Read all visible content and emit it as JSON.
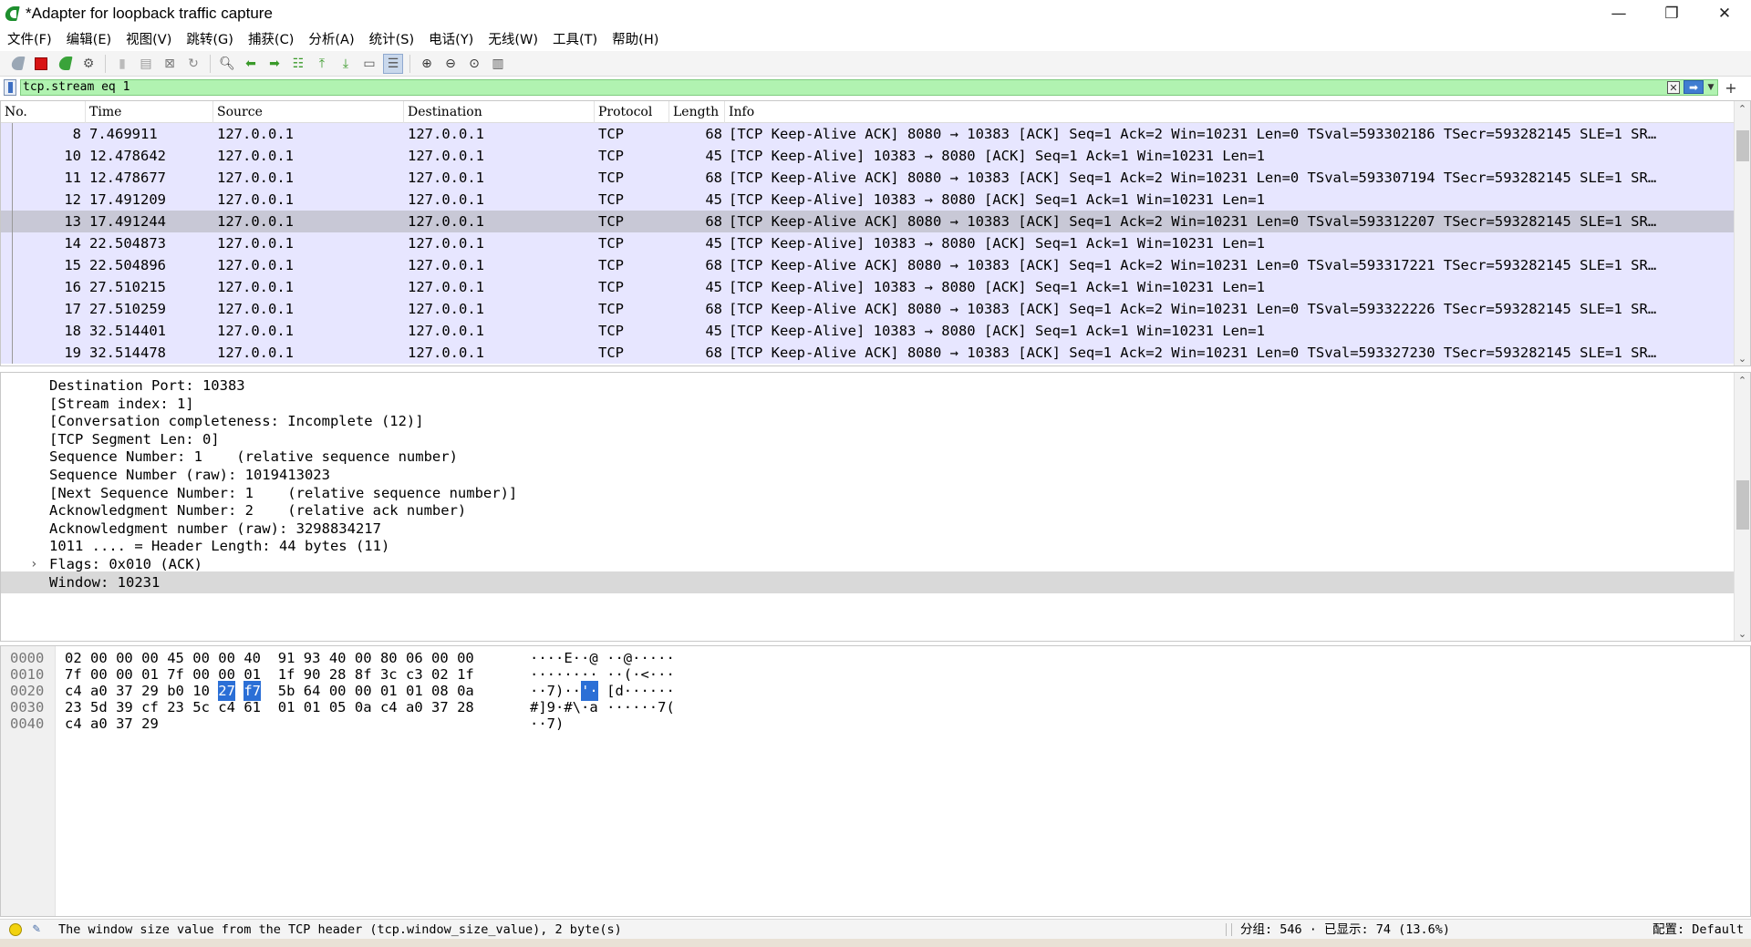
{
  "window": {
    "title": "*Adapter for loopback traffic capture",
    "controls": {
      "minimize": "—",
      "restore": "❐",
      "close": "✕"
    }
  },
  "menu": [
    "文件(F)",
    "编辑(E)",
    "视图(V)",
    "跳转(G)",
    "捕获(C)",
    "分析(A)",
    "统计(S)",
    "电话(Y)",
    "无线(W)",
    "工具(T)",
    "帮助(H)"
  ],
  "toolbar_icons": [
    "start-capture-icon",
    "stop-capture-icon",
    "restart-capture-icon",
    "capture-options-icon",
    "open-file-icon",
    "save-file-icon",
    "close-file-icon",
    "reload-file-icon",
    "find-packet-icon",
    "go-back-icon",
    "go-forward-icon",
    "go-to-packet-icon",
    "go-first-icon",
    "go-last-icon",
    "autoscroll-icon",
    "colorize-icon",
    "zoom-in-icon",
    "zoom-out-icon",
    "zoom-normal-icon",
    "resize-columns-icon"
  ],
  "filter": {
    "value": "tcp.stream eq 1",
    "valid_color": "#b1f3b1"
  },
  "packet_list": {
    "columns": [
      "No.",
      "Time",
      "Source",
      "Destination",
      "Protocol",
      "Length",
      "Info"
    ],
    "rows": [
      {
        "no": "8",
        "time": "7.469911",
        "src": "127.0.0.1",
        "dst": "127.0.0.1",
        "proto": "TCP",
        "len": "68",
        "info": "[TCP Keep-Alive ACK] 8080 → 10383 [ACK] Seq=1 Ack=2 Win=10231 Len=0 TSval=593302186 TSecr=593282145 SLE=1 SR…"
      },
      {
        "no": "10",
        "time": "12.478642",
        "src": "127.0.0.1",
        "dst": "127.0.0.1",
        "proto": "TCP",
        "len": "45",
        "info": "[TCP Keep-Alive] 10383 → 8080 [ACK] Seq=1 Ack=1 Win=10231 Len=1"
      },
      {
        "no": "11",
        "time": "12.478677",
        "src": "127.0.0.1",
        "dst": "127.0.0.1",
        "proto": "TCP",
        "len": "68",
        "info": "[TCP Keep-Alive ACK] 8080 → 10383 [ACK] Seq=1 Ack=2 Win=10231 Len=0 TSval=593307194 TSecr=593282145 SLE=1 SR…"
      },
      {
        "no": "12",
        "time": "17.491209",
        "src": "127.0.0.1",
        "dst": "127.0.0.1",
        "proto": "TCP",
        "len": "45",
        "info": "[TCP Keep-Alive] 10383 → 8080 [ACK] Seq=1 Ack=1 Win=10231 Len=1"
      },
      {
        "no": "13",
        "time": "17.491244",
        "src": "127.0.0.1",
        "dst": "127.0.0.1",
        "proto": "TCP",
        "len": "68",
        "info": "[TCP Keep-Alive ACK] 8080 → 10383 [ACK] Seq=1 Ack=2 Win=10231 Len=0 TSval=593312207 TSecr=593282145 SLE=1 SR…",
        "selected": true
      },
      {
        "no": "14",
        "time": "22.504873",
        "src": "127.0.0.1",
        "dst": "127.0.0.1",
        "proto": "TCP",
        "len": "45",
        "info": "[TCP Keep-Alive] 10383 → 8080 [ACK] Seq=1 Ack=1 Win=10231 Len=1"
      },
      {
        "no": "15",
        "time": "22.504896",
        "src": "127.0.0.1",
        "dst": "127.0.0.1",
        "proto": "TCP",
        "len": "68",
        "info": "[TCP Keep-Alive ACK] 8080 → 10383 [ACK] Seq=1 Ack=2 Win=10231 Len=0 TSval=593317221 TSecr=593282145 SLE=1 SR…"
      },
      {
        "no": "16",
        "time": "27.510215",
        "src": "127.0.0.1",
        "dst": "127.0.0.1",
        "proto": "TCP",
        "len": "45",
        "info": "[TCP Keep-Alive] 10383 → 8080 [ACK] Seq=1 Ack=1 Win=10231 Len=1"
      },
      {
        "no": "17",
        "time": "27.510259",
        "src": "127.0.0.1",
        "dst": "127.0.0.1",
        "proto": "TCP",
        "len": "68",
        "info": "[TCP Keep-Alive ACK] 8080 → 10383 [ACK] Seq=1 Ack=2 Win=10231 Len=0 TSval=593322226 TSecr=593282145 SLE=1 SR…"
      },
      {
        "no": "18",
        "time": "32.514401",
        "src": "127.0.0.1",
        "dst": "127.0.0.1",
        "proto": "TCP",
        "len": "45",
        "info": "[TCP Keep-Alive] 10383 → 8080 [ACK] Seq=1 Ack=1 Win=10231 Len=1"
      },
      {
        "no": "19",
        "time": "32.514478",
        "src": "127.0.0.1",
        "dst": "127.0.0.1",
        "proto": "TCP",
        "len": "68",
        "info": "[TCP Keep-Alive ACK] 8080 → 10383 [ACK] Seq=1 Ack=2 Win=10231 Len=0 TSval=593327230 TSecr=593282145 SLE=1 SR…"
      }
    ],
    "row_color": "#e7e6ff",
    "selected_color": "#c8c8d6"
  },
  "details": {
    "lines": [
      {
        "text": "Destination Port: 10383"
      },
      {
        "text": "[Stream index: 1]"
      },
      {
        "text": "[Conversation completeness: Incomplete (12)]"
      },
      {
        "text": "[TCP Segment Len: 0]"
      },
      {
        "text": "Sequence Number: 1    (relative sequence number)"
      },
      {
        "text": "Sequence Number (raw): 1019413023"
      },
      {
        "text": "[Next Sequence Number: 1    (relative sequence number)]"
      },
      {
        "text": "Acknowledgment Number: 2    (relative ack number)"
      },
      {
        "text": "Acknowledgment number (raw): 3298834217"
      },
      {
        "text": "1011 .... = Header Length: 44 bytes (11)"
      },
      {
        "text": "Flags: 0x010 (ACK)",
        "expander": "›"
      },
      {
        "text": "Window: 10231",
        "selected": true
      }
    ]
  },
  "bytes": {
    "rows": [
      {
        "offset": "0000",
        "hex": [
          "02",
          "00",
          "00",
          "00",
          "45",
          "00",
          "00",
          "40",
          "91",
          "93",
          "40",
          "00",
          "80",
          "06",
          "00",
          "00"
        ],
        "ascii": [
          "····E··@",
          " ··@·····"
        ]
      },
      {
        "offset": "0010",
        "hex": [
          "7f",
          "00",
          "00",
          "01",
          "7f",
          "00",
          "00",
          "01",
          "1f",
          "90",
          "28",
          "8f",
          "3c",
          "c3",
          "02",
          "1f"
        ],
        "ascii": [
          "········",
          " ··(·<···"
        ]
      },
      {
        "offset": "0020",
        "hex": [
          "c4",
          "a0",
          "37",
          "29",
          "b0",
          "10",
          "27",
          "f7",
          "5b",
          "64",
          "00",
          "00",
          "01",
          "01",
          "08",
          "0a"
        ],
        "ascii": [
          "··7)··",
          "'·",
          " [d······"
        ],
        "highlight_hex": [
          6,
          7
        ]
      },
      {
        "offset": "0030",
        "hex": [
          "23",
          "5d",
          "39",
          "cf",
          "23",
          "5c",
          "c4",
          "61",
          "01",
          "01",
          "05",
          "0a",
          "c4",
          "a0",
          "37",
          "28"
        ],
        "ascii": [
          "#]9·#\\·a",
          " ······7("
        ]
      },
      {
        "offset": "0040",
        "hex": [
          "c4",
          "a0",
          "37",
          "29"
        ],
        "ascii": [
          "··7)"
        ]
      }
    ],
    "highlight_color": "#2b6fd6"
  },
  "status": {
    "message": "The window size value from the TCP header (tcp.window_size_value), 2 byte(s)",
    "stats": "分组: 546 · 已显示: 74 (13.6%)",
    "profile": "配置: Default"
  }
}
